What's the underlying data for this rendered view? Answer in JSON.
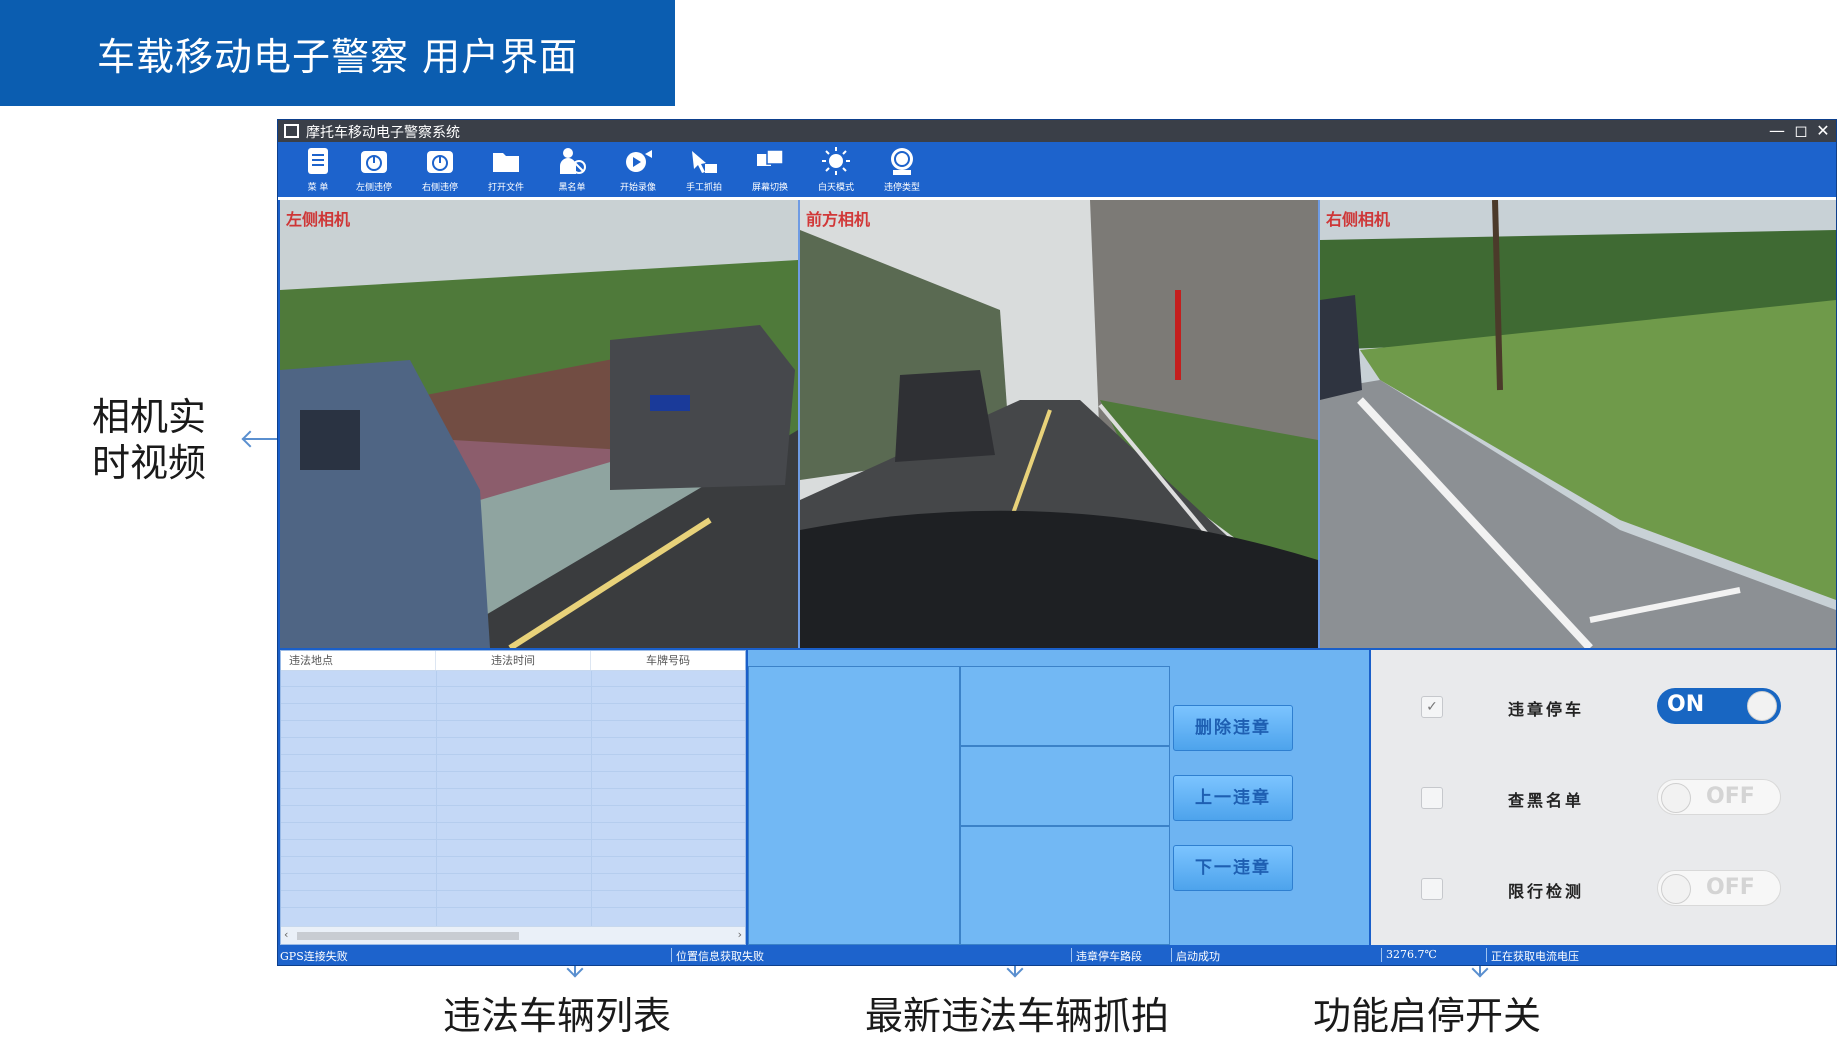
{
  "slide": {
    "title": "车载移动电子警察    用户界面",
    "annotations": {
      "live_video": "相机实时视频",
      "violation_list": "违法车辆列表",
      "latest_capture": "最新违法车辆抓拍",
      "function_toggle": "功能启停开关"
    }
  },
  "window": {
    "title": "摩托车移动电子警察系统",
    "controls": {
      "minimize": "—",
      "restore": "◻",
      "close": "✕"
    }
  },
  "toolbar": {
    "items": [
      {
        "label": "菜 单",
        "icon": "menu-icon"
      },
      {
        "label": "左侧违停",
        "icon": "left-parking-icon"
      },
      {
        "label": "右侧违停",
        "icon": "right-parking-icon"
      },
      {
        "label": "打开文件",
        "icon": "folder-icon"
      },
      {
        "label": "黑名单",
        "icon": "blacklist-icon"
      },
      {
        "label": "开始录像",
        "icon": "video-record-icon"
      },
      {
        "label": "手工抓拍",
        "icon": "hand-capture-icon"
      },
      {
        "label": "屏幕切换",
        "icon": "screen-switch-icon"
      },
      {
        "label": "白天模式",
        "icon": "sun-icon"
      },
      {
        "label": "违停类型",
        "icon": "parking-type-icon"
      }
    ]
  },
  "videos": [
    {
      "label": "左侧相机"
    },
    {
      "label": "前方相机"
    },
    {
      "label": "右侧相机"
    }
  ],
  "violation_table": {
    "columns": [
      "违法地点",
      "违法时间",
      "车牌号码"
    ],
    "rows": []
  },
  "capture": {
    "buttons": {
      "delete": "删除违章",
      "previous": "上一违章",
      "next": "下一违章"
    }
  },
  "functions": [
    {
      "label": "违章停车",
      "checked": true,
      "state": "ON"
    },
    {
      "label": "查黑名单",
      "checked": false,
      "state": "OFF"
    },
    {
      "label": "限行检测",
      "checked": false,
      "state": "OFF"
    }
  ],
  "status": {
    "gps": "GPS连接失败",
    "location": "位置信息获取失败",
    "section": "违章停车路段",
    "start": "启动成功",
    "temperature": "3276.7℃",
    "current": "正在获取电流电压"
  },
  "colors": {
    "banner": "#0b5db0",
    "window_blue": "#1d63cc",
    "toggle_on": "#1866c2"
  }
}
